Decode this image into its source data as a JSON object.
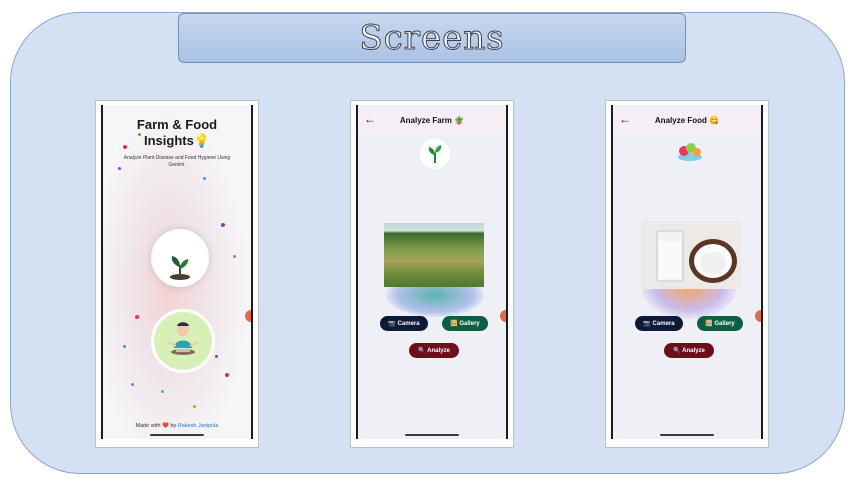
{
  "header": {
    "title": "Screens"
  },
  "screens": [
    {
      "title_line1": "Farm & Food",
      "title_line2": "Insights",
      "title_emoji": "💡",
      "subtitle": "Analyze Plant Disease and Food Hygiene Using Gemini.",
      "footer_prefix": "Made with",
      "footer_heart": "❤️",
      "footer_by": "by",
      "footer_author": "Rakesh Janipula"
    },
    {
      "title": "Analyze Farm 🪴",
      "back_icon": "←",
      "camera_label": "📷 Camera",
      "gallery_label": "🖼️ Gallery",
      "analyze_label": "🔍 Analyze"
    },
    {
      "title": "Analyze Food 😋",
      "back_icon": "←",
      "camera_label": "📷 Camera",
      "gallery_label": "🖼️ Gallery",
      "analyze_label": "🔍 Analyze"
    }
  ],
  "colors": {
    "camera": "#0f1a3a",
    "gallery": "#0e5e44",
    "analyze": "#6e0e1c",
    "link": "#2f72d6"
  },
  "icons": [
    "leaf-icon",
    "sprout-icon",
    "meditating-person-icon",
    "back-arrow-icon",
    "food-icon",
    "heart-icon"
  ]
}
